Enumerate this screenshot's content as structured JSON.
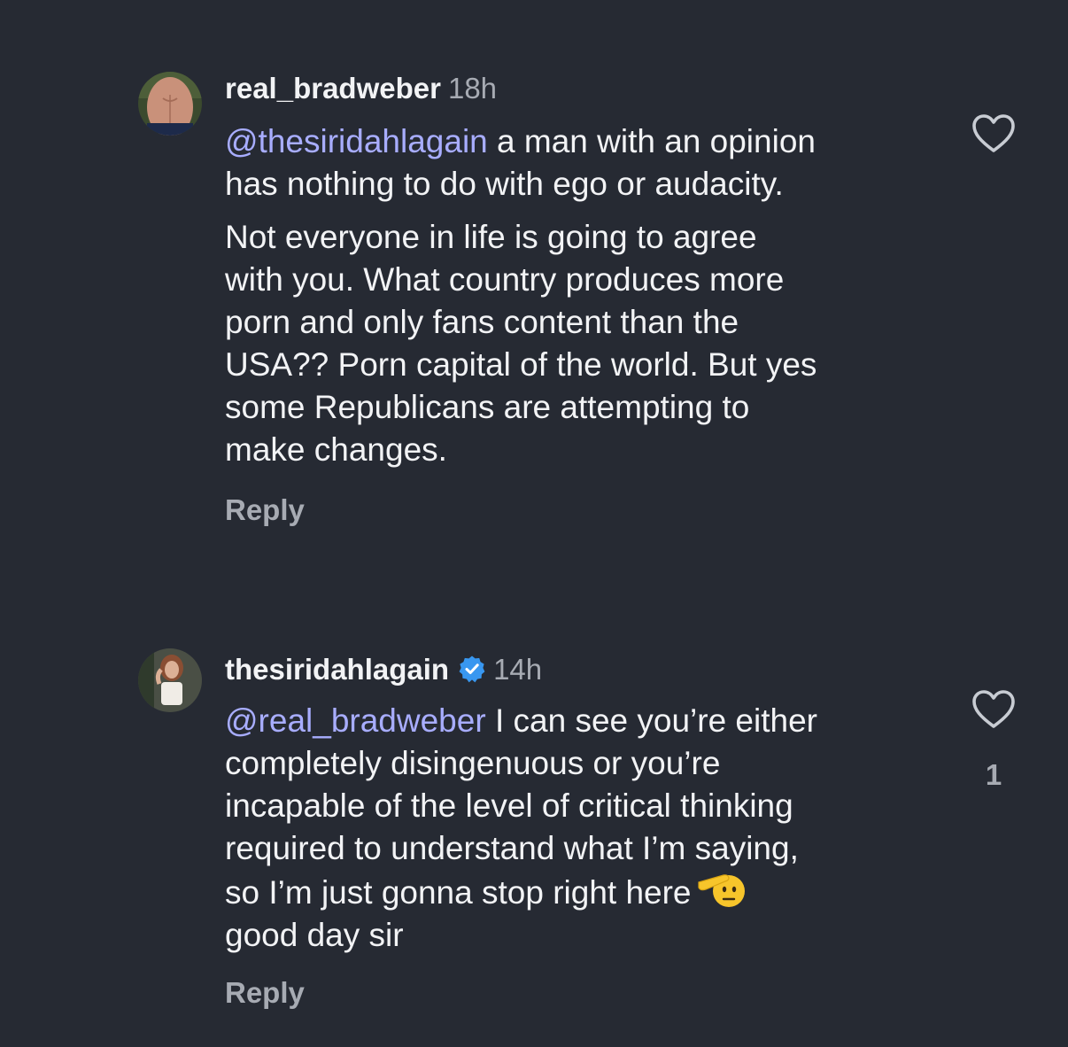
{
  "comments": [
    {
      "username": "real_bradweber",
      "time": "18h",
      "mention": "@thesiridahlagain",
      "line1_rest": " a man with an opinion",
      "line2": "has nothing to do with ego or audacity.",
      "paragraph2": [
        "Not everyone in life is going to agree",
        "with you. What country produces more",
        "porn  and only fans content than the",
        "USA?? Porn capital of the world. But yes",
        "some Republicans are attempting to",
        "make changes."
      ],
      "reply_label": "Reply",
      "avatar_icon": "shirtless-torso-avatar"
    },
    {
      "username": "thesiridahlagain",
      "verified_icon": "verified-badge-icon",
      "time": "14h",
      "mention": "@real_bradweber",
      "line1_rest": " I can see you’re either",
      "lines": [
        "completely disingenuous or you’re",
        "incapable of the level of critical thinking",
        "required to understand what I’m saying,",
        "so I’m just gonna stop right here"
      ],
      "emoji": "saluting-face-emoji",
      "last_line": "good day sir",
      "reply_label": "Reply",
      "likes": "1",
      "avatar_icon": "woman-portrait-avatar"
    }
  ],
  "colors": {
    "background": "#262a33",
    "mention": "#a8adff",
    "muted": "#a7abb3",
    "verified": "#3897f0"
  }
}
